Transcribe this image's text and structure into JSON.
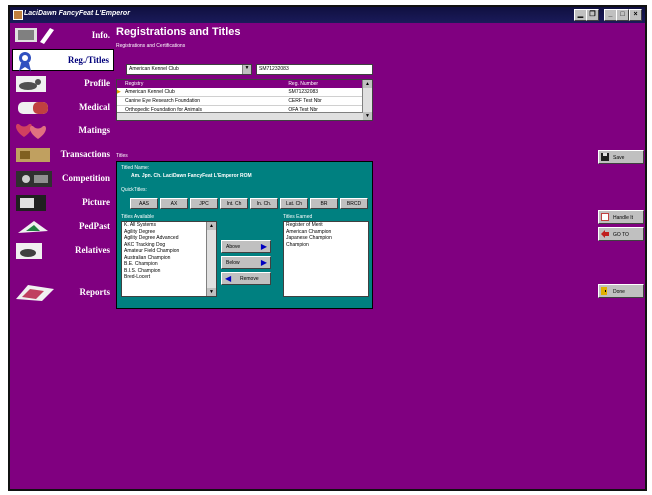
{
  "window": {
    "title": "LaciDawn FancyFeat L'Emperor",
    "controls": [
      "▁",
      "❐",
      "_",
      "□",
      "×"
    ]
  },
  "sidebar": {
    "items": [
      {
        "label": "Info.",
        "icon": "dog-info-icon"
      },
      {
        "label": "Reg./Titles",
        "icon": "ribbon-icon",
        "active": true
      },
      {
        "label": "Profile",
        "icon": "dog-profile-icon"
      },
      {
        "label": "Medical",
        "icon": "medical-icon"
      },
      {
        "label": "Matings",
        "icon": "matings-icon"
      },
      {
        "label": "Transactions",
        "icon": "transactions-icon"
      },
      {
        "label": "Competition",
        "icon": "competition-icon"
      },
      {
        "label": "Picture",
        "icon": "picture-icon"
      },
      {
        "label": "PedPast",
        "icon": "pedigree-icon"
      },
      {
        "label": "Relatives",
        "icon": "relatives-icon"
      },
      {
        "label": "Reports",
        "icon": "reports-icon"
      }
    ]
  },
  "header": {
    "title": "Registrations and Titles",
    "subtitle": "Registrations and Certifications"
  },
  "registry_select": {
    "value": "American Kennel Club"
  },
  "reg_number_field": {
    "value": "SM71232083"
  },
  "reg_table": {
    "columns": [
      "Registry",
      "Reg. Number"
    ],
    "rows": [
      {
        "registry": "American Kennel Club",
        "number": "SM71232083",
        "selected": true
      },
      {
        "registry": "Canine Eye Research Foundation",
        "number": "CERF Test Nbr"
      },
      {
        "registry": "Orthopedic Foundation for Animals",
        "number": "OFA Test Nbr"
      }
    ]
  },
  "titles": {
    "section_label": "Titles",
    "titled_name_label": "Titled Name:",
    "titled_name": "Am. Jpn. Ch. LaciDawn FancyFeat L'Emperor ROM",
    "quick_titles_label": "QuickTitles:",
    "quick_buttons": [
      "AAS",
      "AX",
      "JPC",
      "Int. Ch",
      "In. Ch.",
      "Lat. Ch",
      "BR",
      "BRCD"
    ],
    "available_label": "Titles Available",
    "earned_label": "Titles Earned",
    "available": [
      "K. All Systems",
      "Agility Degree",
      "Agility Degree Advanced",
      "AKC Tracking Dog",
      "Amateur Field Champion",
      "Australian Champion",
      "B.E. Champion",
      "B.I.S. Champion",
      "Bred-Locert"
    ],
    "earned": [
      "Register of Merit",
      "American Champion",
      "Japanese Champion",
      "Champion"
    ],
    "move_buttons": {
      "above": "Above",
      "below": "Below",
      "remove": "Remove"
    }
  },
  "right_buttons": {
    "save": "Save",
    "handle_it": "Handle It",
    "goto": "GO TO",
    "done": "Done"
  },
  "colors": {
    "background": "#800080",
    "titles_panel": "#008080"
  }
}
